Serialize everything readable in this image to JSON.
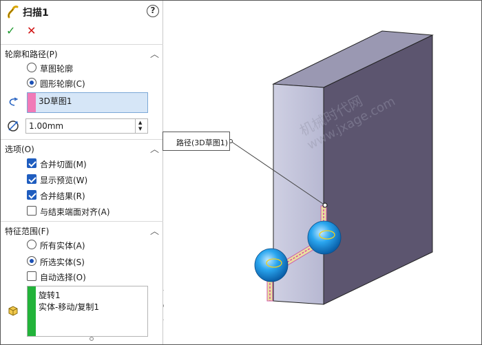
{
  "feature": {
    "title": "扫描1",
    "help_icon": "?",
    "ok_icon": "✓",
    "cancel_icon": "✕",
    "icon": "sweep-icon"
  },
  "profile_path": {
    "header": "轮廓和路径(P)",
    "options": [
      {
        "label": "草图轮廓",
        "selected": false
      },
      {
        "label": "圆形轮廓(C)",
        "selected": true
      }
    ],
    "path_selection": "3D草图1",
    "diameter": "1.00mm"
  },
  "options_group": {
    "header": "选项(O)",
    "items": [
      {
        "label": "合并切面(M)",
        "checked": true
      },
      {
        "label": "显示预览(W)",
        "checked": true
      },
      {
        "label": "合并结果(R)",
        "checked": true
      },
      {
        "label": "与结束端面对齐(A)",
        "checked": false
      }
    ]
  },
  "feature_scope": {
    "header": "特征范围(F)",
    "options": [
      {
        "label": "所有实体(A)",
        "selected": false
      },
      {
        "label": "所选实体(S)",
        "selected": true
      }
    ],
    "auto_select": {
      "label": "自动选择(O)",
      "checked": false
    },
    "bodies": [
      "旋转1",
      "实体-移动/复制1"
    ]
  },
  "viewport": {
    "callout": "路径(3D草图1)",
    "watermark_line1": "机械时代网",
    "watermark_line2": "www.jxage.com"
  },
  "colors": {
    "ok": "#1f9a2f",
    "cancel": "#d01010",
    "selection_bg": "#d6e6f7",
    "profile_swatch": "#f07ab8",
    "bodies_swatch": "#22b33a",
    "sphere": "#2a9be0"
  }
}
